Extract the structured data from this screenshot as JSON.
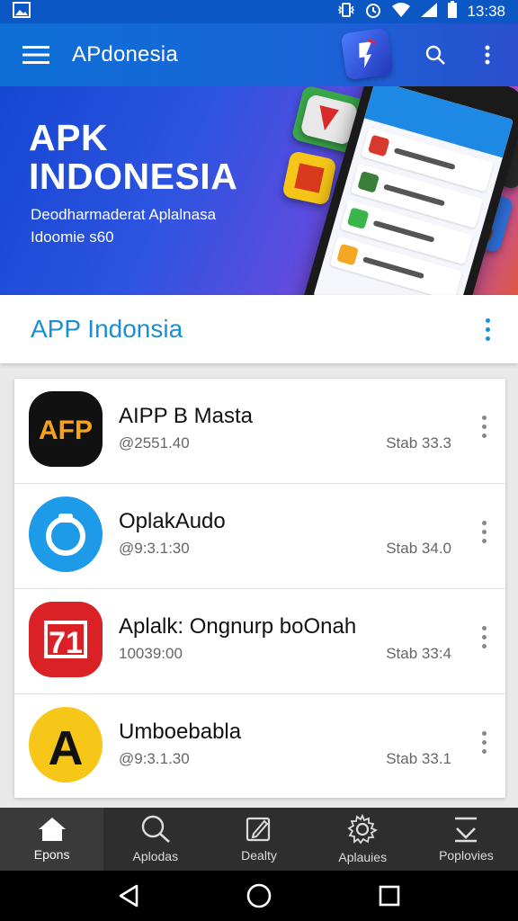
{
  "status_bar": {
    "time": "13:38",
    "icons": [
      "image-icon",
      "vibrate-icon",
      "alarm-icon",
      "wifi-icon",
      "signal-icon",
      "battery-icon"
    ]
  },
  "app_bar": {
    "title": "APdonesia",
    "menu_icon": "hamburger-menu-icon",
    "search_icon": "search-icon",
    "more_icon": "more-vert-icon"
  },
  "hero": {
    "title_line1": "APK",
    "title_line2": "INDONESIA",
    "subtitle_line1": "Deodharmaderat Aplalnasa",
    "subtitle_line2": "Idoomie s60"
  },
  "section": {
    "title": "APP Indonsia"
  },
  "apps": [
    {
      "name": "AIPP B Masta",
      "meta": "@2551.40",
      "version": "Stab 33.3",
      "icon_text": "AFP",
      "icon_bg": "#111111",
      "icon_fg": "#f6a31b"
    },
    {
      "name": "OplakAudo",
      "meta": "@9:3.1:30",
      "version": "Stab 34.0",
      "icon_text": "",
      "icon_bg": "#1e9be8",
      "icon_fg": "#ffffff"
    },
    {
      "name": "Aplalk: Ongnurp boOnah",
      "meta": "10039:00",
      "version": "Stab 33:4",
      "icon_text": "71",
      "icon_bg": "#d92126",
      "icon_fg": "#ffffff"
    },
    {
      "name": "Umboebabla",
      "meta": "@9:3.1.30",
      "version": "Stab 33.1",
      "icon_text": "A",
      "icon_bg": "#f6c619",
      "icon_fg": "#111111"
    }
  ],
  "bottom_nav": [
    {
      "label": "Epons",
      "icon": "home-icon",
      "active": true
    },
    {
      "label": "Aplodas",
      "icon": "search-icon",
      "active": false
    },
    {
      "label": "Dealty",
      "icon": "edit-icon",
      "active": false
    },
    {
      "label": "Aplauies",
      "icon": "settings-icon",
      "active": false
    },
    {
      "label": "Poplovies",
      "icon": "download-icon",
      "active": false
    }
  ],
  "system_nav": [
    "back-icon",
    "home-circle-icon",
    "recents-icon"
  ]
}
